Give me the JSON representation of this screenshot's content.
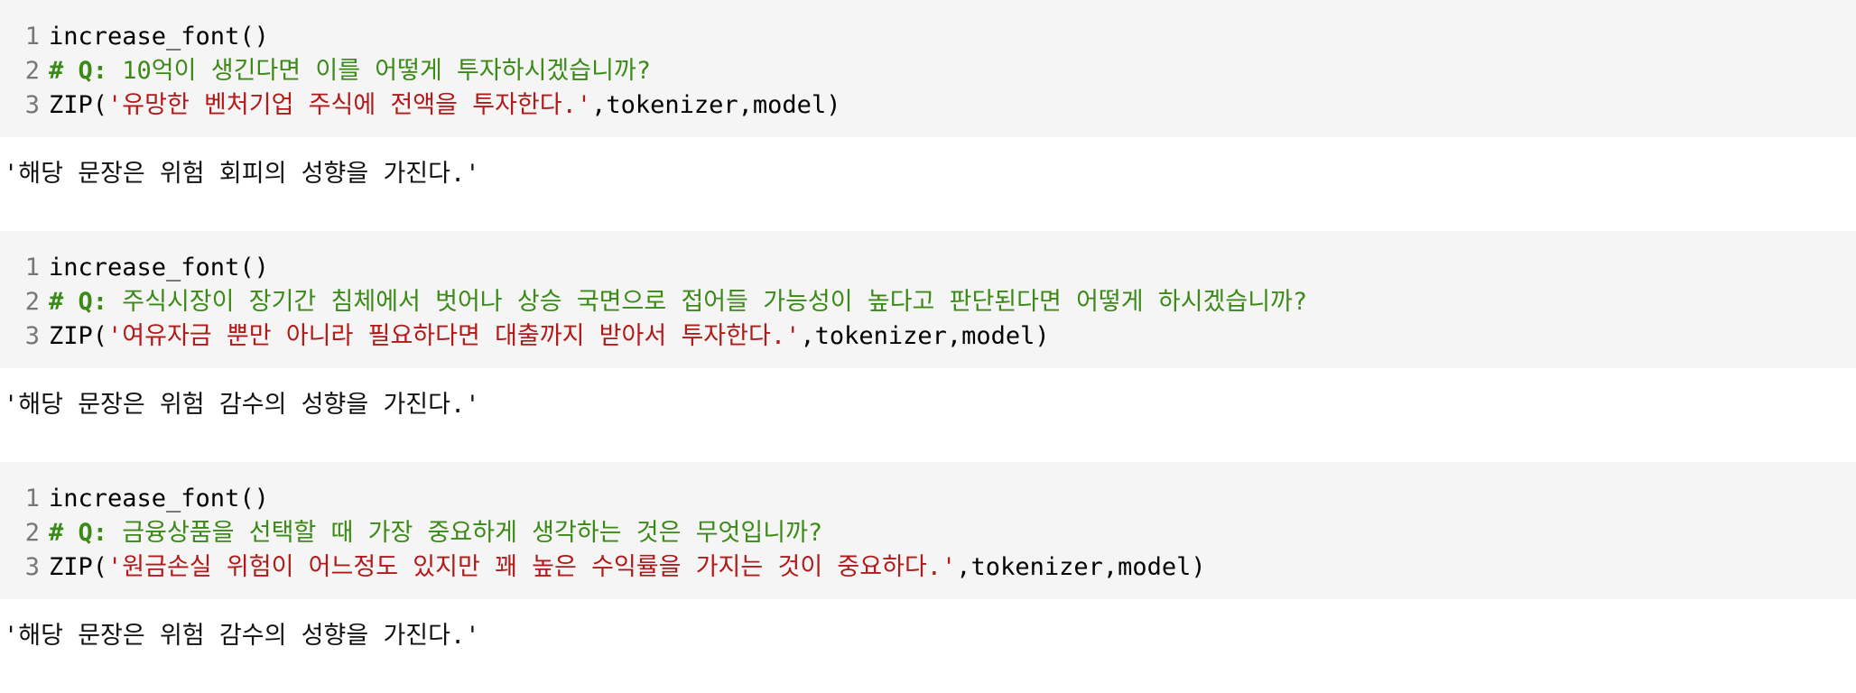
{
  "cells": [
    {
      "input": {
        "line_numbers": [
          "1",
          "2",
          "3"
        ],
        "line1": "increase_font()",
        "comment_prefix": "# Q:",
        "comment_text": " 10억이 생긴다면 이를 어떻게 투자하시겠습니까?",
        "call_open": "ZIP(",
        "string_literal": "'유망한 벤처기업 주식에 전액을 투자한다.'",
        "call_args": ",tokenizer,model)"
      },
      "output": "'해당 문장은 위험 회피의 성향을 가진다.'"
    },
    {
      "input": {
        "line_numbers": [
          "1",
          "2",
          "3"
        ],
        "line1": "increase_font()",
        "comment_prefix": "# Q:",
        "comment_text": " 주식시장이 장기간 침체에서 벗어나 상승 국면으로 접어들 가능성이 높다고 판단된다면 어떻게 하시겠습니까?",
        "call_open": "ZIP(",
        "string_literal": "'여유자금 뿐만 아니라 필요하다면 대출까지 받아서 투자한다.'",
        "call_args": ",tokenizer,model)"
      },
      "output": "'해당 문장은 위험 감수의 성향을 가진다.'"
    },
    {
      "input": {
        "line_numbers": [
          "1",
          "2",
          "3"
        ],
        "line1": "increase_font()",
        "comment_prefix": "# Q:",
        "comment_text": " 금융상품을 선택할 때 가장 중요하게 생각하는 것은 무엇입니까?",
        "call_open": "ZIP(",
        "string_literal": "'원금손실 위험이 어느정도 있지만 꽤 높은 수익률을 가지는 것이 중요하다.'",
        "call_args": ",tokenizer,model)"
      },
      "output": "'해당 문장은 위험 감수의 성향을 가진다.'"
    }
  ],
  "colors": {
    "input_bg": "#f5f5f5",
    "comment": "#3b8a17",
    "string": "#b21a1a",
    "line_number": "#777777"
  }
}
